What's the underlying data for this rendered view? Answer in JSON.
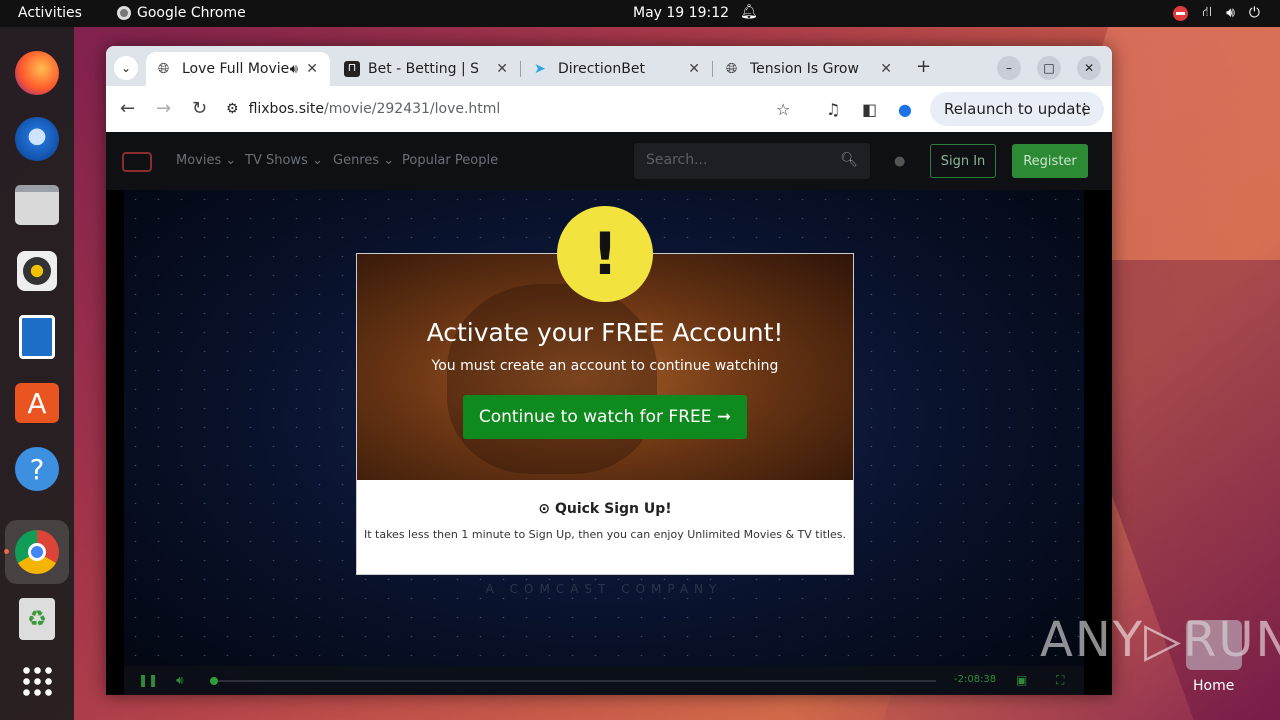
{
  "topbar": {
    "activities": "Activities",
    "app_name": "Google Chrome",
    "clock": "May 19  19:12"
  },
  "dock": {
    "items": [
      "firefox-icon",
      "thunderbird-icon",
      "files-icon",
      "rhythmbox-icon",
      "writer-icon",
      "software-icon",
      "help-icon",
      "chrome-icon",
      "trash-icon",
      "apps-grid-icon"
    ]
  },
  "browser": {
    "tabs": [
      {
        "title": "Love Full Movie",
        "active": true
      },
      {
        "title": "Bet - Betting | Sports",
        "active": false
      },
      {
        "title": "DirectionBet",
        "active": false
      },
      {
        "title": "Tension Is Growing",
        "active": false
      }
    ],
    "url_host": "flixbos.site",
    "url_path": "/movie/292431/love.html",
    "relaunch": "Relaunch to update"
  },
  "site": {
    "nav": [
      "Movies ⌄",
      "TV Shows ⌄",
      "Genres ⌄",
      "Popular People"
    ],
    "search_placeholder": "Search...",
    "signin": "Sign In",
    "register": "Register",
    "video_caption": "A COMCAST COMPANY",
    "time_remaining": "-2:08:38",
    "progress": 0.0
  },
  "modal": {
    "title": "Activate your FREE Account!",
    "subtitle": "You must create an account to continue watching",
    "cta": "Continue to watch for FREE ➞",
    "quick_title": "⊙ Quick Sign Up!",
    "quick_text": "It takes less then 1 minute to Sign Up, then you can enjoy Unlimited Movies & TV titles."
  },
  "watermark": {
    "text": "ANY▷RUN",
    "home_label": "Home"
  },
  "colors": {
    "accent_green": "#0f8a1e",
    "warning_yellow": "#f2e33f"
  }
}
